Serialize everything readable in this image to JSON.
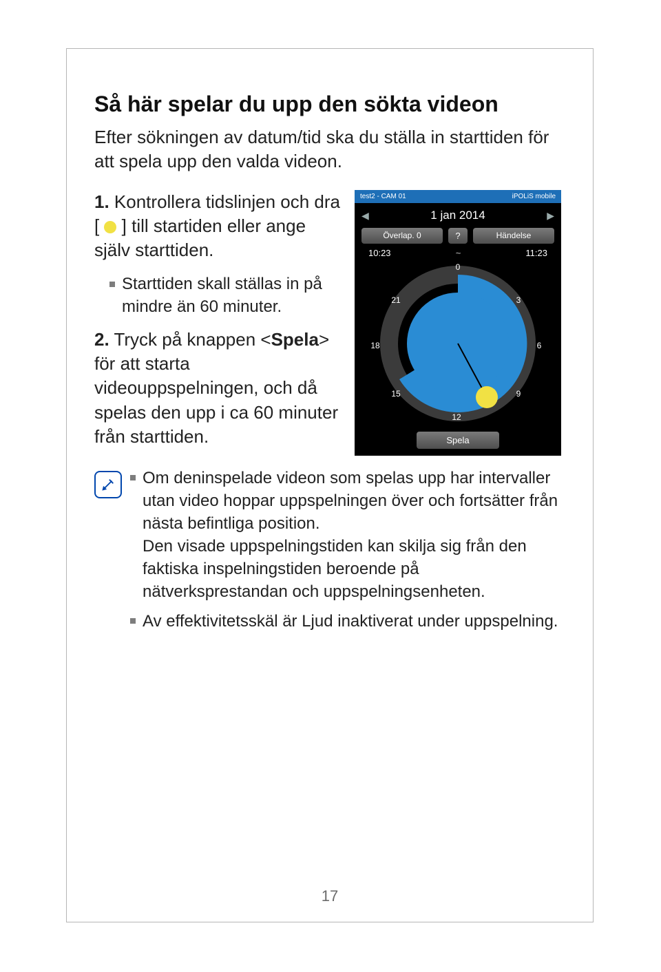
{
  "title": "Så här spelar du upp den sökta videon",
  "intro": "Efter sökningen av datum/tid ska du ställa in starttiden för att spela upp den valda videon.",
  "step1_num": "1.",
  "step1_a": "Kontrollera tidslinjen och dra [ ",
  "step1_b": " ] till startiden eller ange själv starttiden.",
  "sub1": "Starttiden skall ställas in på mindre än 60 minuter.",
  "step2_num": "2.",
  "step2_a": "Tryck på knappen <",
  "step2_bold": "Spela",
  "step2_b": "> för att starta videouppspelningen, och då spelas den upp i ca 60 minuter från starttiden.",
  "note1_a": "Om deninspelade videon som spelas upp har intervaller utan video hoppar uppspelningen över och fortsätter från nästa befintliga position.",
  "note1_b": "Den visade uppspelningstiden kan skilja sig från den faktiska inspelningstiden beroende på nätverksprestandan och uppspelningsenheten.",
  "note2": "Av effektivitetsskäl är Ljud inaktiverat under uppspelning.",
  "page_number": "17",
  "phone": {
    "app_left": "test2 - CAM 01",
    "app_right": "iPOLiS mobile",
    "date": "1 jan 2014",
    "overlap_btn": "Överlap. 0",
    "q_btn": "?",
    "event_btn": "Händelse",
    "t_start": "10:23",
    "t_tilde": "~",
    "t_end": "11:23",
    "h0": "0",
    "h3": "3",
    "h6": "6",
    "h9": "9",
    "h12": "12",
    "h15": "15",
    "h18": "18",
    "h21": "21",
    "play": "Spela"
  }
}
